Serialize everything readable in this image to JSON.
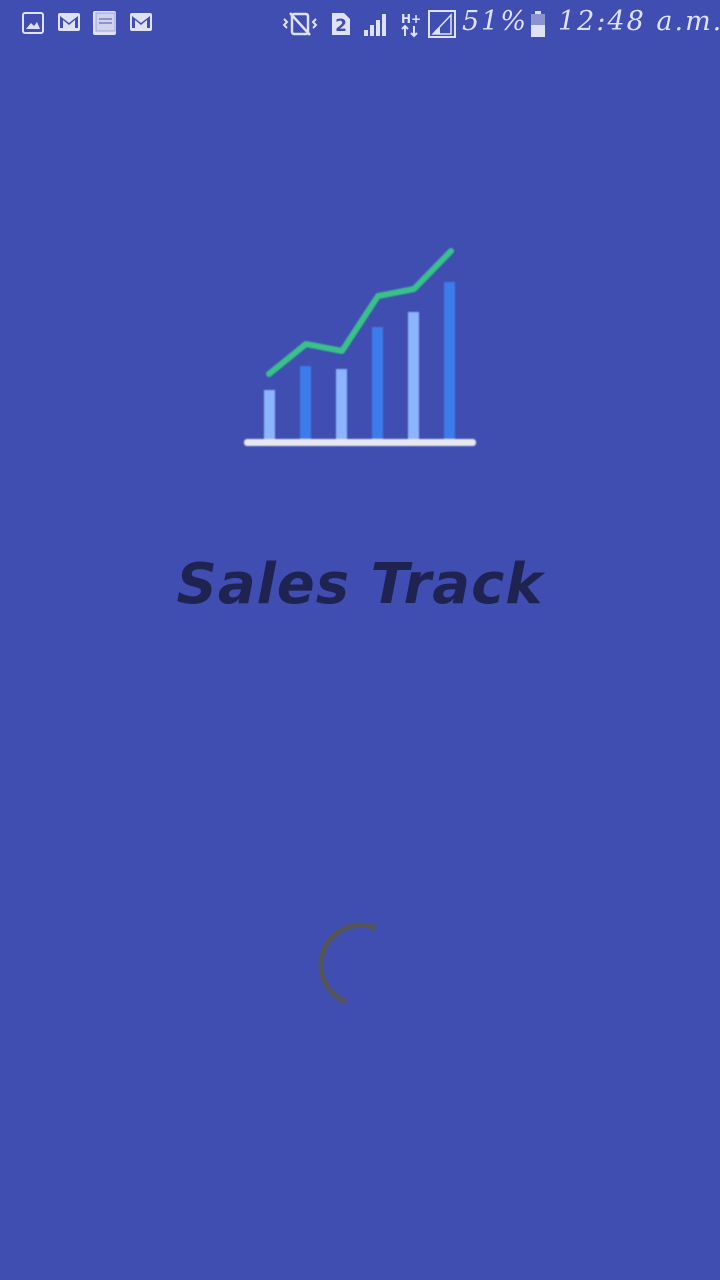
{
  "status_bar": {
    "left_icons": [
      "gallery-icon",
      "gmail-icon",
      "bible-app-icon",
      "gmail-icon"
    ],
    "right_icons": [
      "vibrate-icon",
      "sim2-icon",
      "signal-icon",
      "hplus-data-icon",
      "signal-outline-icon",
      "battery-icon"
    ],
    "battery_text": "51%",
    "time": "12:48 a.m."
  },
  "splash": {
    "app_name": "Sales Track",
    "logo": "sales-chart-logo-icon",
    "loading": "loading-spinner",
    "colors": {
      "background": "#404db1",
      "trend_line": "#39c28a",
      "bar_light": "#8cb4ff",
      "bar_dark": "#3b7bea",
      "title": "#1e2352",
      "spinner": "#555555"
    }
  }
}
